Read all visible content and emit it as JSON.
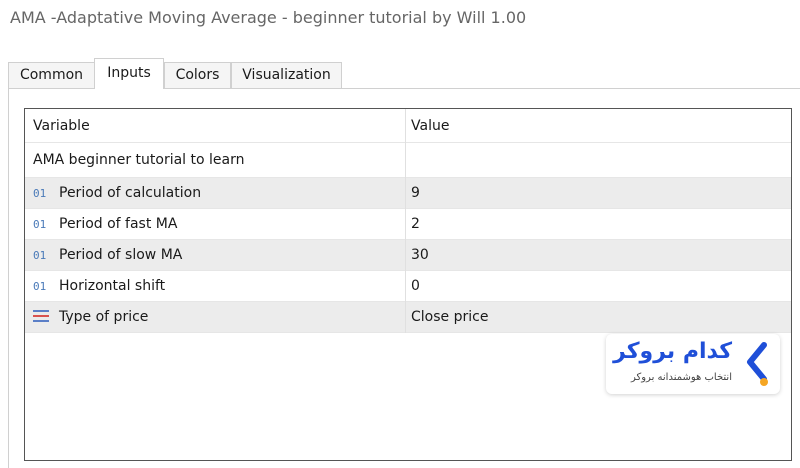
{
  "window": {
    "title": "AMA  -Adaptative Moving Average - beginner tutorial by Will 1.00"
  },
  "tabs": [
    {
      "label": "Common",
      "active": false
    },
    {
      "label": "Inputs",
      "active": true
    },
    {
      "label": "Colors",
      "active": false
    },
    {
      "label": "Visualization",
      "active": false
    }
  ],
  "grid": {
    "columns": {
      "variable": "Variable",
      "value": "Value"
    },
    "rows": [
      {
        "icon": "none",
        "variable": "AMA beginner tutorial to learn",
        "value": ""
      },
      {
        "icon": "01",
        "variable": "Period of calculation",
        "value": "9"
      },
      {
        "icon": "01",
        "variable": "Period of fast MA",
        "value": "2"
      },
      {
        "icon": "01",
        "variable": "Period of slow MA",
        "value": "30"
      },
      {
        "icon": "01",
        "variable": "Horizontal shift",
        "value": "0"
      },
      {
        "icon": "list-icon",
        "variable": "Type of price",
        "value": "Close price"
      }
    ]
  },
  "watermark": {
    "name": "کدام بروکر",
    "tagline": "انتخاب هوشمندانه بروکر"
  },
  "colors": {
    "int_icon": "#4a7ab8",
    "list_icon_red": "#d9534f",
    "list_icon_blue": "#5b7fc7",
    "logo_blue": "#1f4fd8",
    "logo_orange": "#f5a623"
  }
}
